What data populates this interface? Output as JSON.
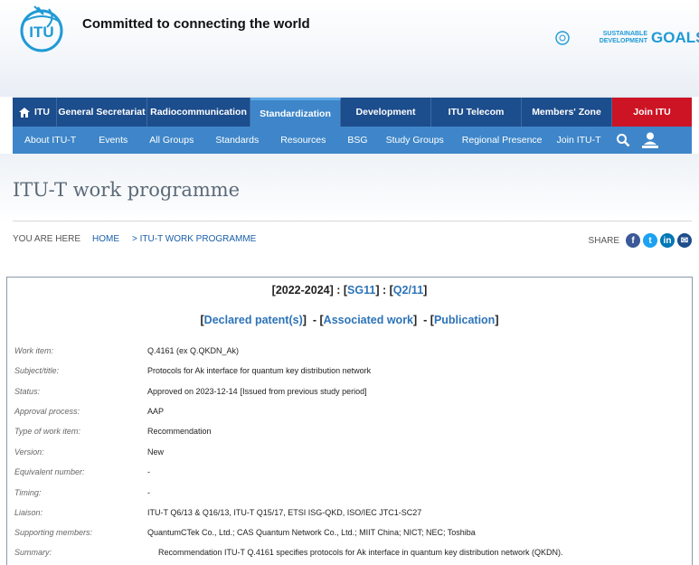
{
  "header": {
    "logo_text": "ITU",
    "tagline": "Committed to connecting the world",
    "sdg_line1": "SUSTAINABLE",
    "sdg_line2": "DEVELOPMENT",
    "sdg_goals": "GOALS"
  },
  "nav_primary": [
    {
      "label": "ITU"
    },
    {
      "label": "General Secretariat"
    },
    {
      "label": "Radiocommunication"
    },
    {
      "label": "Standardization"
    },
    {
      "label": "Development"
    },
    {
      "label": "ITU Telecom"
    },
    {
      "label": "Members' Zone"
    },
    {
      "label": "Join ITU"
    }
  ],
  "nav_secondary": [
    {
      "label": "About ITU-T"
    },
    {
      "label": "Events"
    },
    {
      "label": "All Groups"
    },
    {
      "label": "Standards"
    },
    {
      "label": "Resources"
    },
    {
      "label": "BSG"
    },
    {
      "label": "Study Groups"
    },
    {
      "label": "Regional Presence"
    },
    {
      "label": "Join ITU-T"
    }
  ],
  "page": {
    "title": "ITU-T work programme",
    "breadcrumb_label": "YOU ARE HERE",
    "breadcrumb_home": "HOME",
    "breadcrumb_current": "> ITU-T WORK PROGRAMME",
    "share_label": "SHARE"
  },
  "panel": {
    "period": "[2022-2024]",
    "sep": " : ",
    "sg_open": "[",
    "sg": "SG11",
    "sg_close": "]",
    "q_open": "[",
    "q": "Q2/11",
    "q_close": "]",
    "patents": "Declared patent(s)",
    "assoc": "Associated work",
    "publication": "Publication"
  },
  "fields": [
    {
      "key": "Work item:",
      "value": "Q.4161 (ex Q.QKDN_Ak)"
    },
    {
      "key": "Subject/title:",
      "value": "Protocols for Ak interface for quantum key distribution network"
    },
    {
      "key": "Status:",
      "value": "Approved on 2023-12-14",
      "extra": "[Issued from previous study period]"
    },
    {
      "key": "Approval process:",
      "value": "AAP"
    },
    {
      "key": "Type of work item:",
      "value": "Recommendation"
    },
    {
      "key": "Version:",
      "value": "New"
    },
    {
      "key": "Equivalent number:",
      "value": "-"
    },
    {
      "key": "Timing:",
      "value": "-"
    },
    {
      "key": "Liaison:",
      "value": "ITU-T Q6/13 & Q16/13, ITU-T Q15/17, ETSI ISG-QKD, ISO/IEC JTC1-SC27"
    },
    {
      "key": "Supporting members:",
      "value": "QuantumCTek Co., Ltd.; CAS Quantum Network Co., Ltd.; MIIT China; NICT; NEC; Toshiba"
    },
    {
      "key": "Summary:",
      "value": "Recommendation ITU-T Q.4161 specifies protocols for Ak interface in quantum key distribution network (QKDN)."
    }
  ],
  "colors": {
    "nav_dark": "#1c4d8c",
    "nav_light": "#3e86c9",
    "join_red": "#cc1424",
    "link_blue": "#2c73b8",
    "status_green": "#1a8a1a",
    "facebook": "#3b5998",
    "twitter": "#1da1f2",
    "linkedin": "#0077b5",
    "email": "#1c4d8c"
  },
  "icons": [
    "home-icon",
    "search-icon",
    "user-icon",
    "facebook-icon",
    "twitter-icon",
    "linkedin-icon",
    "email-icon"
  ]
}
